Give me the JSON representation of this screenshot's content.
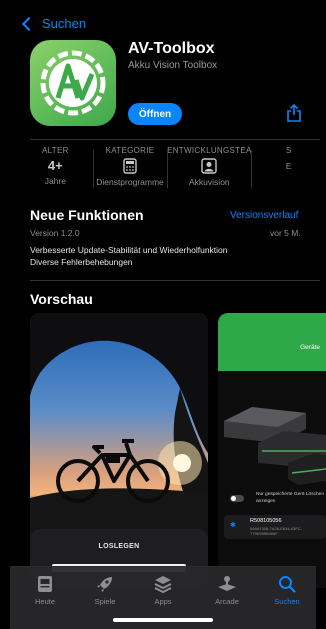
{
  "nav": {
    "back_label": "Suchen"
  },
  "app": {
    "name": "AV-Toolbox",
    "subtitle": "Akku Vision Toolbox",
    "open_label": "Öffnen"
  },
  "info": [
    {
      "head": "ALTER",
      "big": "4+",
      "val": "Jahre"
    },
    {
      "head": "KATEGORIE",
      "big": "",
      "val": "Dienstprogramme"
    },
    {
      "head": "ENTWICKLUNGSTEA",
      "big": "",
      "val": "Akkuvision"
    },
    {
      "head": "S",
      "big": "",
      "val": "E"
    }
  ],
  "whats_new": {
    "title": "Neue Funktionen",
    "history_link": "Versionsverlauf",
    "version": "Version 1.2.0",
    "age": "vor 5 M.",
    "notes": [
      "Verbesserte Update-Stabilität und Wiederholfunktion",
      "Diverse Fehlerbehebungen"
    ]
  },
  "preview": {
    "title": "Vorschau",
    "shot1_button": "LOSLEGEN",
    "shot2_header": "Geräte",
    "shot2_toggle": "Nur gespeicherte Gerä Löschen anzeigen",
    "shot2_device_id": "R508105056",
    "shot2_device_uuid": "566A1308-7A26-E634-63FC-779E555B406F"
  },
  "tabs": [
    {
      "label": "Heute",
      "icon": "today-icon",
      "active": false
    },
    {
      "label": "Spiele",
      "icon": "rocket-icon",
      "active": false
    },
    {
      "label": "Apps",
      "icon": "apps-stack-icon",
      "active": false
    },
    {
      "label": "Arcade",
      "icon": "joystick-icon",
      "active": false
    },
    {
      "label": "Suchen",
      "icon": "search-icon",
      "active": true
    }
  ],
  "colors": {
    "accent": "#0a84ff",
    "background": "#000000",
    "icon_green": "#5fbf55"
  }
}
